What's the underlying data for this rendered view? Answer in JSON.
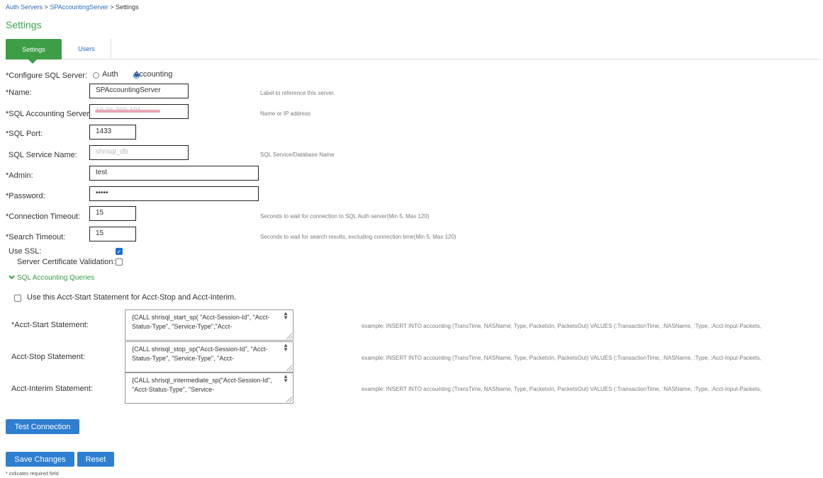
{
  "breadcrumb": {
    "items": [
      "Auth Servers",
      "SPAccountingServer",
      "Settings"
    ],
    "separator": ">"
  },
  "page_title": "Settings",
  "tabs": [
    {
      "label": "Settings",
      "active": true
    },
    {
      "label": "Users",
      "active": false
    }
  ],
  "form": {
    "configure_label": "*Configure SQL Server:",
    "configure_options": [
      {
        "label": "Auth",
        "selected": false
      },
      {
        "label": "Accounting",
        "selected": true
      }
    ],
    "name": {
      "label": "*Name:",
      "value": "SPAccountingServer",
      "hint": "Label to reference this server."
    },
    "server": {
      "label": "*SQL Accounting Server",
      "value": "10.96.209.101",
      "hint": "Name or IP address"
    },
    "port": {
      "label": "*SQL Port:",
      "value": "1433"
    },
    "service": {
      "label": "SQL Service Name:",
      "value": "shrisql_db",
      "hint": "SQL Service/Database Name"
    },
    "admin": {
      "label": "*Admin:",
      "value": "test"
    },
    "password": {
      "label": "*Password:",
      "value": "•••••"
    },
    "conn_timeout": {
      "label": "*Connection Timeout:",
      "value": "15",
      "hint": "Seconds to wait for connection to SQL Auth server(Min 5, Max 120)"
    },
    "search_timeout": {
      "label": "*Search Timeout:",
      "value": "15",
      "hint": "Seconds to wait for search results, excluding connection time(Min 5, Max 120)"
    },
    "use_ssl": {
      "label": "Use SSL:",
      "checked": true
    },
    "cert_validation": {
      "label": "Server Certificate Validation:",
      "checked": false
    }
  },
  "queries": {
    "toggle_label": "SQL Accounting Queries",
    "reuse_label": "Use this Acct-Start Statement for Acct-Stop and Acct-Interim.",
    "statements": [
      {
        "label": "*Acct-Start Statement:",
        "value": "{CALL shrisql_start_sp( \"Acct-Session-Id\", \"Acct-Status-Type\", \"Service-Type\",\"Acct-",
        "example": "example: INSERT INTO accounting (TransTime, NASName, Type, PacketsIn, PacketsOut) VALUES (:TransactionTime, :NASName, :Type, :Acct-Input-Packets,"
      },
      {
        "label": "Acct-Stop Statement:",
        "value": "{CALL shrisql_stop_sp(\"Acct-Session-Id\", \"Acct-Status-Type\", \"Service-Type\", \"Acct-",
        "example": "example: INSERT INTO accounting (TransTime, NASName, Type, PacketsIn, PacketsOut) VALUES (:TransactionTime, :NASName, :Type, :Acct-Input-Packets,"
      },
      {
        "label": "Acct-Interim Statement:",
        "value": "{CALL shrisql_intermediate_sp(\"Acct-Session-Id\", \"Acct-Status-Type\",  \"Service-",
        "example": "example: INSERT INTO accounting (TransTime, NASName, Type, PacketsIn, PacketsOut) VALUES (:TransactionTime, :NASName, :Type, :Acct-Input-Packets,"
      }
    ]
  },
  "buttons": {
    "test_connection": "Test Connection",
    "save": "Save Changes",
    "reset": "Reset"
  },
  "footnote": "* indicates required field",
  "colors": {
    "accent_green": "#3e9e46",
    "link_blue": "#2a6db5",
    "button_blue": "#2f7fd0"
  },
  "icons": {
    "section_toggle": "chevron-down-icon",
    "textarea_spinner": "spinner-arrows-icon"
  }
}
